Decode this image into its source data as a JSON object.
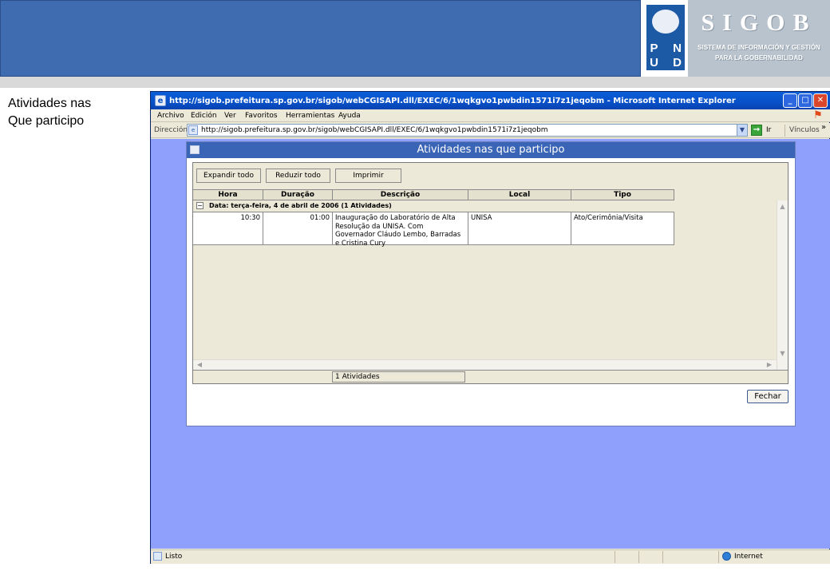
{
  "slide": {
    "side_label_line1": "Atividades nas",
    "side_label_line2": "Que participo",
    "logo": {
      "pnud_letters": [
        "P",
        "N",
        "U",
        "D"
      ],
      "title": "SIGOB",
      "subtitle_line1": "SISTEMA DE INFORMACIÓN Y GESTIÓN",
      "subtitle_line2": "PARA LA GOBERNABILIDAD"
    }
  },
  "browser": {
    "window_title": "http://sigob.prefeitura.sp.gov.br/sigob/webCGISAPI.dll/EXEC/6/1wqkgvo1pwbdin1571i7z1jeqobm - Microsoft Internet Explorer",
    "menu": [
      "Archivo",
      "Edición",
      "Ver",
      "Favoritos",
      "Herramientas",
      "Ayuda"
    ],
    "address_label": "Dirección",
    "address_value": "http://sigob.prefeitura.sp.gov.br/sigob/webCGISAPI.dll/EXEC/6/1wqkgvo1pwbdin1571i7z1jeqobm",
    "go_label": "Ir",
    "links_label": "Vínculos",
    "links_more": "»",
    "status_text": "Listo",
    "zone_text": "Internet"
  },
  "dialog": {
    "title": "Atividades nas que participo",
    "toolbar": {
      "expand_label": "Expandir todo",
      "collapse_label": "Reduzir todo",
      "print_label": "Imprimir"
    },
    "columns": [
      "Hora",
      "Duração",
      "Descrição",
      "Local",
      "Tipo"
    ],
    "group_label": "Data: terça-feira, 4 de abril de 2006 (1 Atividades)",
    "rows": [
      {
        "hora": "10:30",
        "duracao": "01:00",
        "descricao": "Inauguração do Laboratório de Alta Resolução da UNISA. Com Governador Cláudo Lembo, Barradas e Cristina Cury",
        "local": "UNISA",
        "tipo": "Ato/Cerimônia/Visita"
      }
    ],
    "count_label": "1 Atividades",
    "close_label": "Fechar"
  }
}
